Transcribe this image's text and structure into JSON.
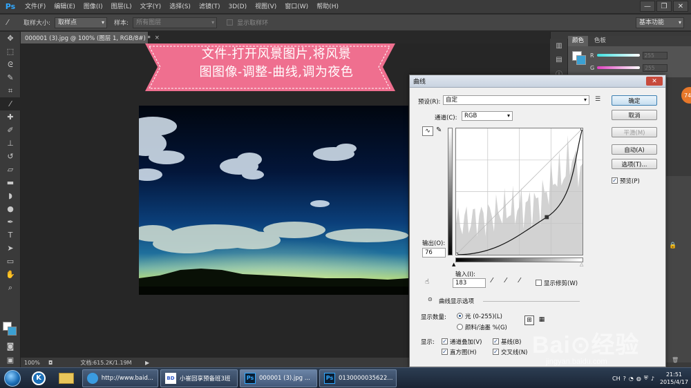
{
  "app": {
    "logo": "Ps",
    "menus": [
      "文件(F)",
      "编辑(E)",
      "图像(I)",
      "图层(L)",
      "文字(Y)",
      "选择(S)",
      "滤镜(T)",
      "3D(D)",
      "视图(V)",
      "窗口(W)",
      "帮助(H)"
    ],
    "window_controls": {
      "minimize": "—",
      "maximize": "❐",
      "close": "✕"
    }
  },
  "options_bar": {
    "sample_size_label": "取样大小:",
    "sample_size_value": "取样点",
    "sample_label": "样本:",
    "sample_value": "所有图层",
    "show_ring_label": "显示取样环",
    "workspace": "基本功能"
  },
  "document": {
    "tab_title": "000001 (3).jpg @ 100% (图层 1, RGB/8#) *",
    "zoom": "100%",
    "doc_info": "文档:615.2K/1.19M"
  },
  "banner": {
    "line1": "文件-打开风景图片,将风景",
    "line2": "图图像-调整-曲线,调为夜色"
  },
  "panels": {
    "tabs": [
      "颜色",
      "色板"
    ],
    "r_label": "R",
    "g_label": "G",
    "r_value": "255",
    "g_value": "255",
    "badge": "74"
  },
  "curves": {
    "title": "曲线",
    "close": "✕",
    "preset_label": "预设(R):",
    "preset_value": "自定",
    "channel_label": "通道(C):",
    "channel_value": "RGB",
    "output_label": "输出(O):",
    "output_value": "76",
    "input_label": "输入(I):",
    "input_value": "183",
    "show_clipping_label": "显示修剪(W)",
    "options_label": "曲线显示选项",
    "show_amount_label": "显示数量:",
    "light_label": "光 (0-255)(L)",
    "pigment_label": "颜料/油墨 %(G)",
    "show_label": "显示:",
    "channel_overlay_label": "通道叠加(V)",
    "baseline_label": "基线(B)",
    "histogram_label": "直方图(H)",
    "intersection_label": "交叉线(N)",
    "buttons": {
      "ok": "确定",
      "cancel": "取消",
      "smooth": "平滑(M)",
      "auto": "自动(A)",
      "options": "选项(T)..."
    },
    "preview_label": "预览(P)",
    "curve_points": [
      [
        0,
        0
      ],
      [
        183,
        76
      ],
      [
        255,
        255
      ]
    ]
  },
  "taskbar": {
    "tasks": [
      {
        "label": "http://www.baid..."
      },
      {
        "label": "小崔回享预备班3班"
      },
      {
        "label": "000001 (3).jpg ..."
      },
      {
        "label": "0130000035622..."
      }
    ],
    "lang": "CH",
    "time": "21:51",
    "date": "2015/4/17"
  },
  "watermark": {
    "brand": "Bai⊙经验",
    "url": "jingyan.baidu.com"
  }
}
